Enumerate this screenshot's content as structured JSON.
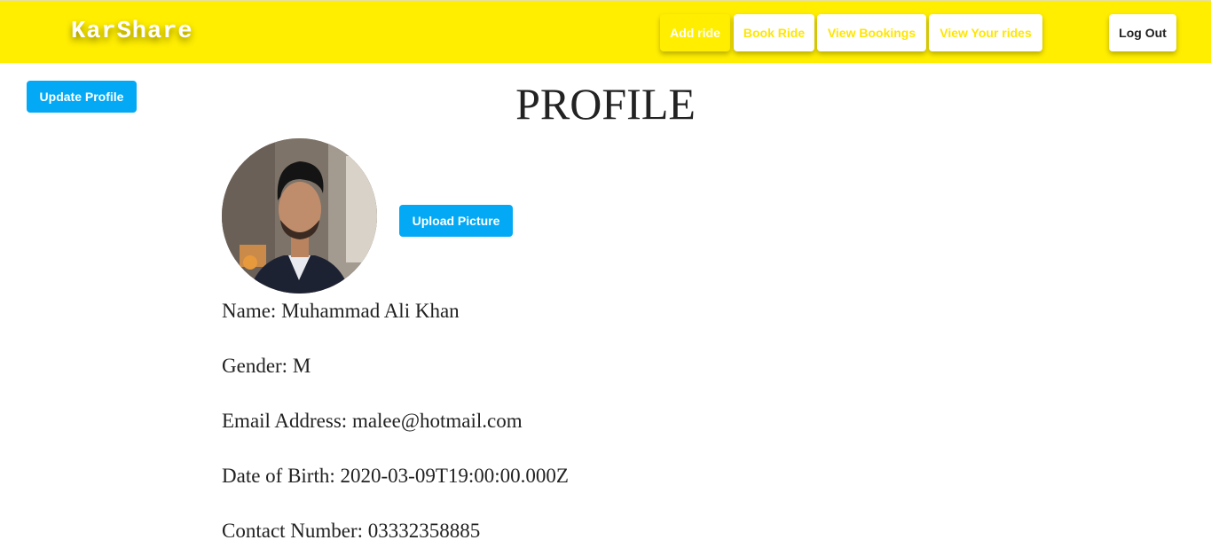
{
  "navbar": {
    "brand": "KarShare",
    "add_ride": "Add ride",
    "book_ride": "Book Ride",
    "view_bookings": "View Bookings",
    "view_your_rides": "View Your rides",
    "log_out": "Log Out"
  },
  "sidebar": {
    "update_profile": "Update Profile"
  },
  "profile": {
    "title": "PROFILE",
    "upload_picture": "Upload Picture",
    "name_label": "Name:",
    "name": "Muhammad Ali Khan",
    "gender_label": "Gender:",
    "gender": "M",
    "email_label": "Email Address:",
    "email": "malee@hotmail.com",
    "dob_label": "Date of Birth:",
    "dob": "2020-03-09T19:00:00.000Z",
    "contact_label": "Contact Number:",
    "contact": "03332358885"
  },
  "colors": {
    "navbar_bg": "#ffee00",
    "button_blue": "#03a9f4",
    "text_dark": "#222222"
  }
}
